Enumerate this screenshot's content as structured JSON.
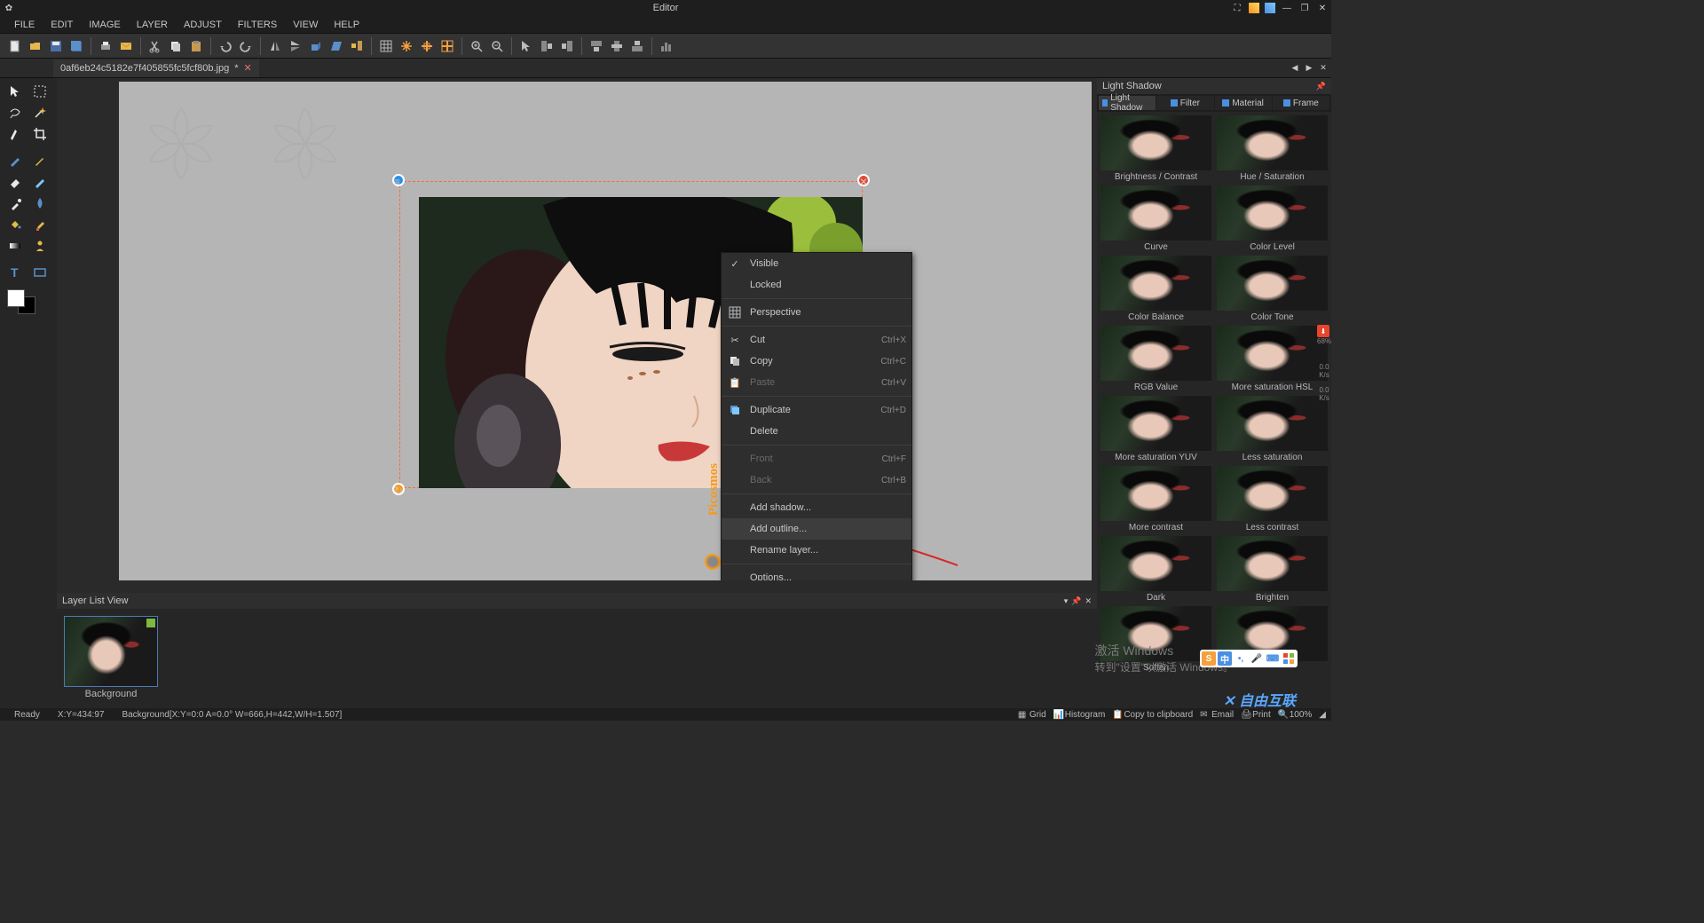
{
  "title": "Editor",
  "menubar": [
    "FILE",
    "EDIT",
    "IMAGE",
    "LAYER",
    "ADJUST",
    "FILTERS",
    "VIEW",
    "HELP"
  ],
  "tab": {
    "name": "0af6eb24c5182e7f405855fc5fcf80b.jpg",
    "dirty": "*"
  },
  "layerpanel": {
    "title": "Layer List View",
    "layer0": "Background"
  },
  "rightpanel": {
    "title": "Light Shadow",
    "tabs": [
      "Light Shadow",
      "Filter",
      "Material",
      "Frame"
    ],
    "items": [
      "Brightness / Contrast",
      "Hue / Saturation",
      "Curve",
      "Color Level",
      "Color Balance",
      "Color Tone",
      "RGB Value",
      "More saturation HSL",
      "More saturation YUV",
      "Less saturation",
      "More contrast",
      "Less contrast",
      "Dark",
      "Brighten",
      "Soften",
      ""
    ],
    "side_pct": "68%",
    "side_unit1": "0.0",
    "side_unit2": "K/s"
  },
  "contextmenu": {
    "visible": "Visible",
    "locked": "Locked",
    "perspective": "Perspective",
    "cut": "Cut",
    "cut_sc": "Ctrl+X",
    "copy": "Copy",
    "copy_sc": "Ctrl+C",
    "paste": "Paste",
    "paste_sc": "Ctrl+V",
    "duplicate": "Duplicate",
    "duplicate_sc": "Ctrl+D",
    "delete": "Delete",
    "front": "Front",
    "front_sc": "Ctrl+F",
    "back": "Back",
    "back_sc": "Ctrl+B",
    "addshadow": "Add shadow...",
    "addoutline": "Add outline...",
    "rename": "Rename layer...",
    "options": "Options..."
  },
  "watermark": "Picosmos",
  "activation": {
    "line1": "激活 Windows",
    "line2": "转到\"设置\"以激活 Windows。"
  },
  "logosite": "自由互联",
  "ime": {
    "brand": "S",
    "char": "中"
  },
  "status": {
    "ready": "Ready",
    "coord": "X:Y=434:97",
    "layerinfo": "Background[X:Y=0:0 A=0.0° W=666,H=442,W/H=1.507]",
    "grid": "Grid",
    "hist": "Histogram",
    "clip": "Copy to clipboard",
    "email": "Email",
    "print": "Print",
    "zoom": "100%"
  }
}
